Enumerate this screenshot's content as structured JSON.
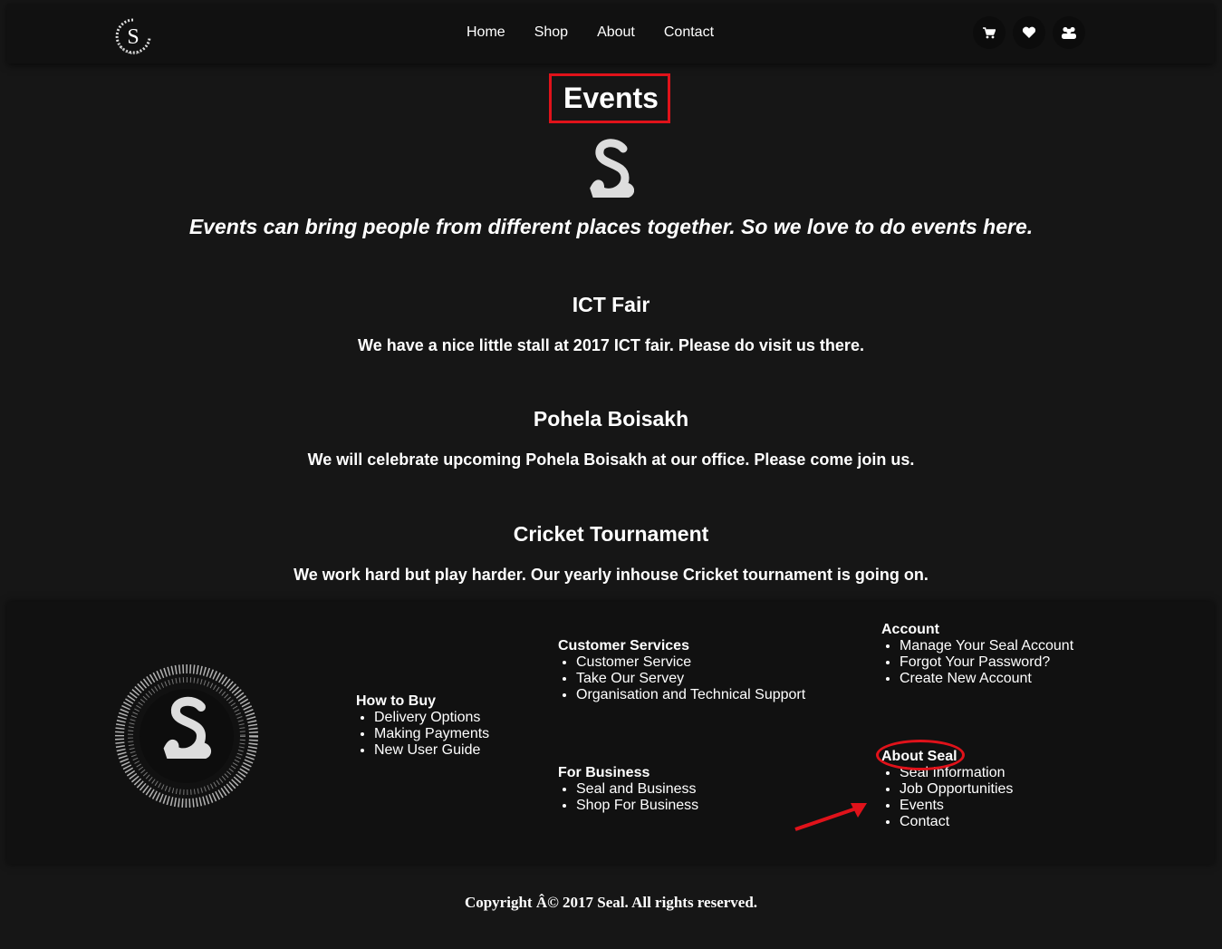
{
  "nav": {
    "logo_letter": "S",
    "links": [
      "Home",
      "Shop",
      "About",
      "Contact"
    ],
    "icons": [
      "cart-icon",
      "heart-icon",
      "users-icon"
    ]
  },
  "page": {
    "title": "Events",
    "tagline": "Events can bring people from different places together. So we love to do events here."
  },
  "events": [
    {
      "title": "ICT Fair",
      "desc": "We have a nice little stall at 2017 ICT fair. Please do visit us there."
    },
    {
      "title": "Pohela Boisakh",
      "desc": "We will celebrate upcoming Pohela Boisakh at our office. Please come join us."
    },
    {
      "title": "Cricket Tournament",
      "desc": "We work hard but play harder. Our yearly inhouse Cricket tournament is going on."
    }
  ],
  "footer": {
    "how_to_buy": {
      "heading": "How to Buy",
      "items": [
        "Delivery Options",
        "Making Payments",
        "New User Guide"
      ]
    },
    "customer_services": {
      "heading": "Customer Services",
      "items": [
        "Customer Service",
        "Take Our Servey",
        "Organisation and Technical Support"
      ]
    },
    "for_business": {
      "heading": "For Business",
      "items": [
        "Seal and Business",
        "Shop For Business"
      ]
    },
    "account": {
      "heading": "Account",
      "items": [
        "Manage Your Seal Account",
        "Forgot Your Password?",
        "Create New Account"
      ]
    },
    "about_seal": {
      "heading": "About Seal",
      "items": [
        "Seal Information",
        "Job Opportunities",
        "Events",
        "Contact"
      ]
    }
  },
  "copyright": "Copyright Â© 2017 Seal. All rights reserved.",
  "colors": {
    "background": "#161616",
    "panel": "#111111",
    "annotation": "#e0121a"
  }
}
